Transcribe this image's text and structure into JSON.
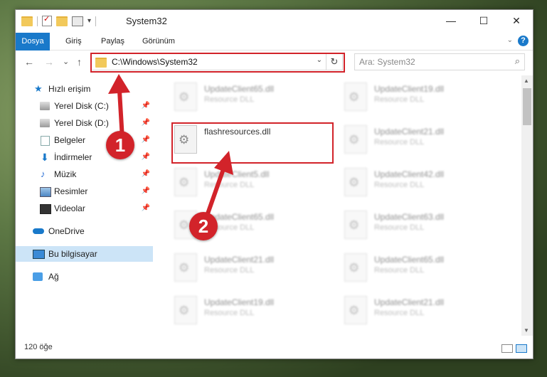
{
  "window": {
    "title": "System32",
    "qat_dropdown": "▾",
    "controls": {
      "minimize": "—",
      "maximize": "☐",
      "close": "✕"
    }
  },
  "ribbon": {
    "tabs": [
      "Dosya",
      "Giriş",
      "Paylaş",
      "Görünüm"
    ],
    "collapse_glyph": "⌄",
    "help_glyph": "?"
  },
  "nav": {
    "back": "←",
    "forward": "→",
    "recent": "⌄",
    "up": "↑"
  },
  "address": {
    "path": "C:\\Windows\\System32",
    "dropdown": "⌄",
    "refresh": "↻"
  },
  "search": {
    "placeholder": "Ara: System32",
    "icon": "⌕"
  },
  "sidebar": {
    "quick_access": "Hızlı erişim",
    "pin_glyph": "📌",
    "items": [
      {
        "label": "Yerel Disk (C:)",
        "icon": "disk-icon"
      },
      {
        "label": "Yerel Disk (D:)",
        "icon": "disk-icon"
      },
      {
        "label": "Belgeler",
        "icon": "documents-icon"
      },
      {
        "label": "İndirmeler",
        "icon": "downloads-icon"
      },
      {
        "label": "Müzik",
        "icon": "music-icon"
      },
      {
        "label": "Resimler",
        "icon": "pictures-icon"
      },
      {
        "label": "Videolar",
        "icon": "videos-icon"
      }
    ],
    "onedrive": "OneDrive",
    "this_pc": "Bu bilgisayar",
    "network": "Ağ"
  },
  "files": {
    "highlighted": {
      "name": "flashresources.dll",
      "type": ""
    },
    "left_column": [
      {
        "name": "UpdateClient65.dll",
        "type": "Resource DLL"
      },
      {
        "name": "UpdateClient5.dll",
        "type": "Resource DLL"
      },
      {
        "name": "UpdateClient65.dll",
        "type": "Resource DLL"
      },
      {
        "name": "UpdateClient21.dll",
        "type": "Resource DLL"
      },
      {
        "name": "UpdateClient19.dll",
        "type": "Resource DLL"
      }
    ],
    "right_column": [
      {
        "name": "UpdateClient19.dll",
        "type": "Resource DLL"
      },
      {
        "name": "UpdateClient21.dll",
        "type": "Resource DLL"
      },
      {
        "name": "UpdateClient42.dll",
        "type": "Resource DLL"
      },
      {
        "name": "UpdateClient63.dll",
        "type": "Resource DLL"
      },
      {
        "name": "UpdateClient65.dll",
        "type": "Resource DLL"
      },
      {
        "name": "UpdateClient21.dll",
        "type": "Resource DLL"
      }
    ]
  },
  "status": {
    "item_count": "120 öğe"
  },
  "annotations": {
    "step1": "1",
    "step2": "2",
    "color": "#d2232a"
  }
}
